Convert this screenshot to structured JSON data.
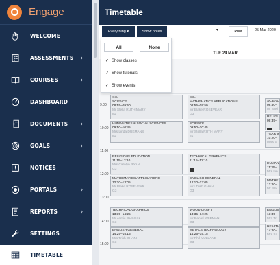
{
  "brand": {
    "name": "Engage"
  },
  "sidebar": {
    "items": [
      {
        "label": "WELCOME",
        "icon": "hand-wave-icon",
        "chevron": false
      },
      {
        "label": "ASSESSMENTS",
        "icon": "clipboard-icon",
        "chevron": true
      },
      {
        "label": "COURSES",
        "icon": "book-icon",
        "chevron": true
      },
      {
        "label": "DASHBOARD",
        "icon": "gauge-icon",
        "chevron": false
      },
      {
        "label": "DOCUMENTS",
        "icon": "document-icon",
        "chevron": true
      },
      {
        "label": "GOALS",
        "icon": "target-icon",
        "chevron": true
      },
      {
        "label": "NOTICES",
        "icon": "notice-icon",
        "chevron": false
      },
      {
        "label": "PORTALS",
        "icon": "globe-icon",
        "chevron": true
      },
      {
        "label": "REPORTS",
        "icon": "report-icon",
        "chevron": true
      },
      {
        "label": "SETTINGS",
        "icon": "wrench-icon",
        "chevron": false
      },
      {
        "label": "TIMETABLE",
        "icon": "calendar-icon",
        "chevron": false,
        "active": true
      }
    ],
    "chevron_glyph": "›"
  },
  "header": {
    "title": "Timetable"
  },
  "toolbar": {
    "everything_label": "Everything ▾",
    "show_notes_label": "Show notes",
    "dropdown_arrow": "▾",
    "print_label": "Print",
    "date_label": "25 Mar 2020"
  },
  "hint": "Y FOR MORE DETAILS AND TO COLOUR IT",
  "column_header": "TUE 24 MAR",
  "dropdown": {
    "all_label": "All",
    "none_label": "None",
    "check_glyph": "✓",
    "options": [
      "Show classes",
      "Show tutorials",
      "Show events"
    ]
  },
  "times": [
    "9:00",
    "10:00",
    "11:00",
    "12:00",
    "13:00",
    "14:00",
    "15:00"
  ],
  "columns": {
    "left": [
      {
        "code": "C3L",
        "title": "SCIENCE",
        "time": "08:55–09:50",
        "teacher": "Mr Stella RUTH MARY",
        "room": "81"
      },
      {
        "title": "HUMANITIES & SOCIAL SCIENCES",
        "time": "09:50–10:45",
        "teacher": "Mrs Linda DUKMANS",
        "room": "81"
      },
      {
        "title": "RELIGIOUS EDUCATION",
        "time": "11:15–12:10",
        "teacher": "Mrs Carolyn RYAN",
        "room": "G3"
      },
      {
        "title": "MATHEMATICS APPLICATIONS",
        "time": "12:10–13:05",
        "teacher": "Mr Blake ROSEVEAR",
        "room": "G3"
      },
      {
        "title": "TECHNICAL GRAPHICS",
        "time": "13:35–14:25",
        "teacher": "Mr Jamie DUGGIN",
        "room": "G3"
      },
      {
        "title": "ENGLISH GENERAL",
        "time": "14:25–15:15",
        "teacher": "Mrs Trish GHANI",
        "room": "G3"
      }
    ],
    "middle": [
      {
        "code": "C3L",
        "title": "MATHEMATICS APPLICATIONS",
        "time": "08:55–09:50",
        "teacher": "Mr Blake ROSEVEAR",
        "room": "G3"
      },
      {
        "title": "SCIENCE",
        "time": "09:50–10:45",
        "teacher": "Mr Stella RUTH MARY",
        "room": "81"
      },
      {
        "title": "TECHNICAL GRAPHICS",
        "time": "11:15–12:10",
        "teacher": "",
        "room": ""
      },
      {
        "title": "ENGLISH GENERAL",
        "time": "12:10–13:05",
        "teacher": "Mrs Trish GHANI",
        "room": "G3"
      },
      {
        "title": "WOOD CRAFT",
        "time": "13:35–14:25",
        "teacher": "Mr Daniel WEEMAN",
        "room": "G3"
      },
      {
        "title": "METALS TECHNOLOGY",
        "time": "14:25–15:15",
        "teacher": "Mr Phil MULLANE",
        "room": "G3"
      }
    ],
    "right": [
      {
        "title": "SCIENCE",
        "time": "08:50–",
        "teacher": "Mr Stell",
        "room": ""
      },
      {
        "title": "RELIGI",
        "time": "09:35–",
        "teacher": "",
        "room": ""
      },
      {
        "title": "YEAR 9",
        "time": "10:20–",
        "teacher": "Miss E",
        "room": ""
      },
      {
        "title": "HUMAN",
        "time": "11:35–",
        "teacher": "Mrs Lin",
        "room": ""
      },
      {
        "title": "MATHE",
        "time": "12:20–",
        "teacher": "Mr Bla",
        "room": ""
      },
      {
        "title": "ENGLIS",
        "time": "13:35–",
        "teacher": "Mrs Tri",
        "room": ""
      },
      {
        "title": "HEALTH",
        "time": "14:20–",
        "teacher": "Mrs Sa",
        "room": ""
      }
    ]
  }
}
